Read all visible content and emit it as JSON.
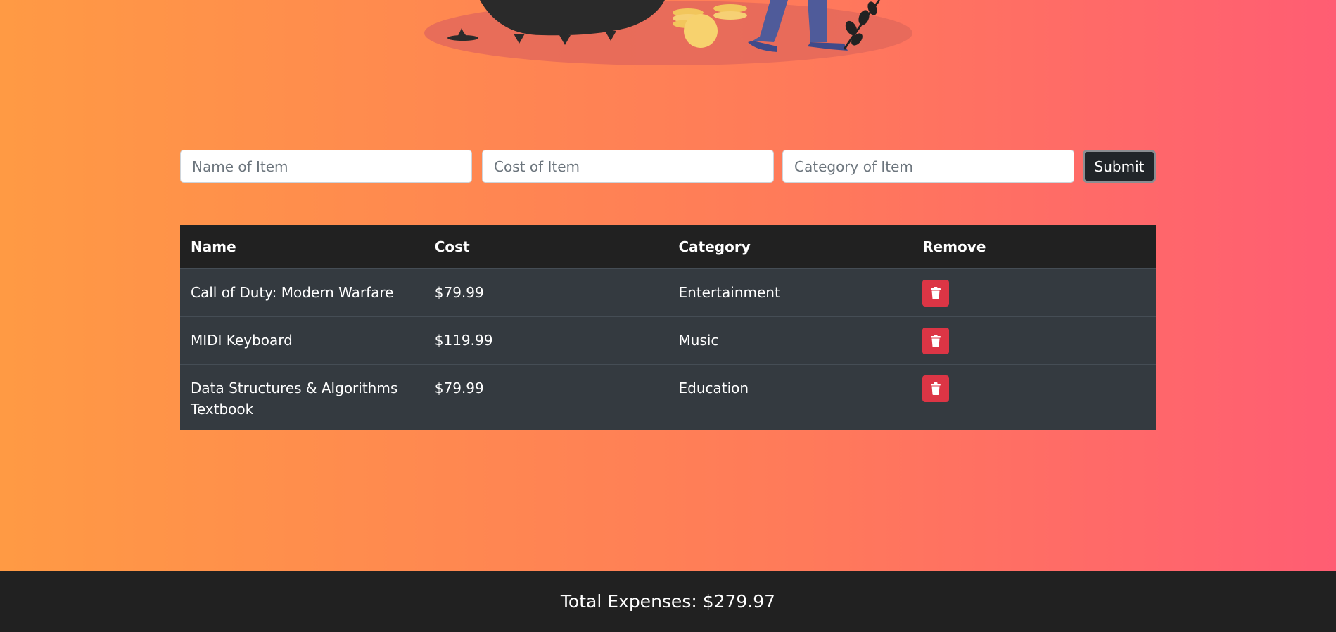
{
  "form": {
    "name_placeholder": "Name of Item",
    "cost_placeholder": "Cost of Item",
    "category_placeholder": "Category of Item",
    "submit_label": "Submit"
  },
  "table": {
    "headers": {
      "name": "Name",
      "cost": "Cost",
      "category": "Category",
      "remove": "Remove"
    },
    "rows": [
      {
        "name": "Call of Duty: Modern Warfare",
        "cost": "$79.99",
        "category": "Entertainment",
        "remove_icon": "trash-icon"
      },
      {
        "name": "MIDI Keyboard",
        "cost": "$119.99",
        "category": "Music",
        "remove_icon": "trash-icon"
      },
      {
        "name": "Data Structures & Algorithms Textbook",
        "cost": "$79.99",
        "category": "Education",
        "remove_icon": "trash-icon"
      }
    ]
  },
  "footer": {
    "total_label": "Total Expenses: $279.97"
  },
  "colors": {
    "gradient_start": "#ff9a44",
    "gradient_end": "#ff5d73",
    "table_header": "#212121",
    "table_row": "#343a40",
    "remove_button": "#dc3545",
    "footer": "#212121",
    "submit_button": "#212529"
  }
}
